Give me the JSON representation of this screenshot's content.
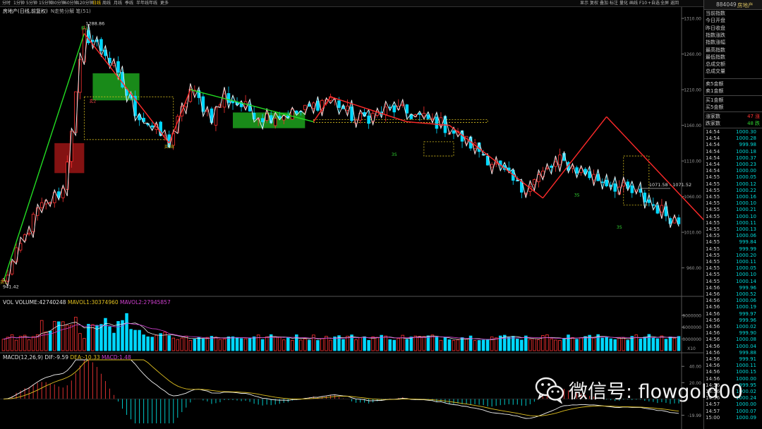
{
  "toolbar": {
    "items": [
      "分时",
      "1分钟",
      "5分钟",
      "15分钟",
      "30分钟",
      "60分钟",
      "120分钟",
      "日线",
      "周线",
      "月线",
      "季线",
      "半年线",
      "年线",
      "更多"
    ],
    "active_index": 7,
    "right_items": [
      "显示",
      "复权",
      "叠加",
      "标注",
      "量化",
      "画线",
      "F10",
      "+自选",
      "全屏",
      "返回"
    ]
  },
  "chart_title": {
    "name": "房地产(日线,前复权)",
    "indicator": "N走势分解 笔(51)"
  },
  "price_axis": {
    "ticks": [
      {
        "label": "1310.00",
        "v": 1310
      },
      {
        "label": "1260.00",
        "v": 1260
      },
      {
        "label": "1210.00",
        "v": 1210
      },
      {
        "label": "1160.00",
        "v": 1160
      },
      {
        "label": "1110.00",
        "v": 1110
      },
      {
        "label": "1060.00",
        "v": 1060
      },
      {
        "label": "1010.00",
        "v": 1010
      },
      {
        "label": "960.00",
        "v": 960
      }
    ],
    "min": 928,
    "max": 1316
  },
  "annotations": {
    "high_label": "1288.86",
    "low_label": "941.42",
    "range_label": "1071.58 - 1071.52",
    "range_value": 1071.5,
    "signals": [
      {
        "label": "买1",
        "i": 0,
        "v": 938,
        "color": "#e0c020"
      },
      {
        "label": "卖1",
        "i": 19,
        "v": 1294,
        "color": "#30d030"
      },
      {
        "label": "卖2",
        "i": 21,
        "v": 1192,
        "color": "#e04040"
      },
      {
        "label": "买3B",
        "i": 39,
        "v": 1128,
        "color": "#e0c020"
      },
      {
        "label": "3S",
        "i": 92,
        "v": 1117,
        "color": "#30d030"
      },
      {
        "label": "3S",
        "i": 135,
        "v": 1060,
        "color": "#30d030"
      },
      {
        "label": "3S",
        "i": 145,
        "v": 1015,
        "color": "#30d030"
      }
    ]
  },
  "vol_legend": {
    "vol": "VOL VOLUME:42740248",
    "mavol1": "MAVOL1:30374960",
    "mavol2": "MAVOL2:27945857"
  },
  "vol_axis": {
    "ticks": [
      {
        "label": "9000000",
        "v": 9000000
      },
      {
        "label": "6000000",
        "v": 6000000
      },
      {
        "label": "3000000",
        "v": 3000000
      }
    ],
    "unit": "X10",
    "max": 11000000
  },
  "macd_legend": {
    "name": "MACD(12,26,9)",
    "dif": "DIF:-9.59",
    "dea": "DEA:-10.33",
    "macd": "MACD:1.48"
  },
  "macd_axis": {
    "ticks": [
      {
        "label": "40.00",
        "v": 40
      },
      {
        "label": "20.00",
        "v": 20
      },
      {
        "label": "-19.99",
        "v": -19.99
      }
    ],
    "min": -30,
    "max": 48
  },
  "side_panel": {
    "code": "884049",
    "name": "房地产",
    "labels": [
      "当前指数",
      "今日开盘",
      "昨日收盘",
      "指数涨跌",
      "指数涨幅",
      "最高指数",
      "最低指数",
      "总成交额",
      "总成交量"
    ],
    "order_labels": [
      "卖5金额",
      "卖1金额",
      "买1金额",
      "买5金额"
    ],
    "up_label": "涨家数",
    "up_value": "47",
    "up_suffix": "涨",
    "down_label": "跌家数",
    "down_value": "48",
    "down_suffix": "跌",
    "trades": [
      {
        "t": "14:54",
        "p": "1000.30"
      },
      {
        "t": "14:54",
        "p": "1000.28"
      },
      {
        "t": "14:54",
        "p": "999.98"
      },
      {
        "t": "14:54",
        "p": "1000.18"
      },
      {
        "t": "14:54",
        "p": "1000.37"
      },
      {
        "t": "14:54",
        "p": "1000.23"
      },
      {
        "t": "14:54",
        "p": "1000.00"
      },
      {
        "t": "14:55",
        "p": "1000.05"
      },
      {
        "t": "14:55",
        "p": "1000.12"
      },
      {
        "t": "14:55",
        "p": "1000.22"
      },
      {
        "t": "14:55",
        "p": "1000.16"
      },
      {
        "t": "14:55",
        "p": "1000.10"
      },
      {
        "t": "14:55",
        "p": "1000.21"
      },
      {
        "t": "14:55",
        "p": "1000.10"
      },
      {
        "t": "14:55",
        "p": "1000.11"
      },
      {
        "t": "14:55",
        "p": "1000.13"
      },
      {
        "t": "14:55",
        "p": "1000.06"
      },
      {
        "t": "14:55",
        "p": "999.84"
      },
      {
        "t": "14:55",
        "p": "999.99"
      },
      {
        "t": "14:55",
        "p": "1000.20"
      },
      {
        "t": "14:55",
        "p": "1000.11"
      },
      {
        "t": "14:55",
        "p": "1000.05"
      },
      {
        "t": "14:55",
        "p": "1000.10"
      },
      {
        "t": "14:55",
        "p": "1000.14"
      },
      {
        "t": "14:56",
        "p": "999.96"
      },
      {
        "t": "14:56",
        "p": "1000.52"
      },
      {
        "t": "14:56",
        "p": "1000.06"
      },
      {
        "t": "14:56",
        "p": "1000.19"
      },
      {
        "t": "14:56",
        "p": "999.97"
      },
      {
        "t": "14:56",
        "p": "999.96"
      },
      {
        "t": "14:56",
        "p": "1000.02"
      },
      {
        "t": "14:56",
        "p": "999.90"
      },
      {
        "t": "14:56",
        "p": "1000.08"
      },
      {
        "t": "14:56",
        "p": "1000.04"
      },
      {
        "t": "14:56",
        "p": "999.88"
      },
      {
        "t": "14:56",
        "p": "999.91"
      },
      {
        "t": "14:56",
        "p": "1000.11"
      },
      {
        "t": "14:56",
        "p": "1000.15"
      },
      {
        "t": "14:56",
        "p": "1000.00"
      },
      {
        "t": "14:56",
        "p": "999.95"
      },
      {
        "t": "14:56",
        "p": "1000.02"
      },
      {
        "t": "14:56",
        "p": "1000.24"
      },
      {
        "t": "14:57",
        "p": "1000.00"
      },
      {
        "t": "14:57",
        "p": "1000.07"
      },
      {
        "t": "15:00",
        "p": "1000.09"
      }
    ]
  },
  "watermark": {
    "text": "微信号: flowgold00"
  },
  "colors": {
    "up": "#ff3232",
    "down": "#00d8ff",
    "bi_red": "#ff2a2a",
    "bi_green": "#22dd22",
    "zone_green": "#22b822",
    "zone_red": "#b01818",
    "dashed": "#d8c020",
    "macd_pos": "#d83030",
    "macd_neg": "#00c8c8"
  },
  "chart_data": {
    "type": "candlestick",
    "count": 158,
    "turning_points": [
      {
        "i": 0,
        "v": 941.42
      },
      {
        "i": 8,
        "v": 1040
      },
      {
        "i": 14,
        "v": 1070
      },
      {
        "i": 19,
        "v": 1288.86
      },
      {
        "i": 24,
        "v": 1262
      },
      {
        "i": 31,
        "v": 1180
      },
      {
        "i": 39,
        "v": 1135
      },
      {
        "i": 44,
        "v": 1210
      },
      {
        "i": 49,
        "v": 1172
      },
      {
        "i": 52,
        "v": 1200
      },
      {
        "i": 61,
        "v": 1172
      },
      {
        "i": 70,
        "v": 1178
      },
      {
        "i": 77,
        "v": 1200
      },
      {
        "i": 83,
        "v": 1167
      },
      {
        "i": 92,
        "v": 1183
      },
      {
        "i": 103,
        "v": 1162
      },
      {
        "i": 112,
        "v": 1125
      },
      {
        "i": 122,
        "v": 1070
      },
      {
        "i": 131,
        "v": 1110
      },
      {
        "i": 138,
        "v": 1090
      },
      {
        "i": 150,
        "v": 1060
      },
      {
        "i": 160,
        "v": 1020
      },
      {
        "i": 170,
        "v": 995
      },
      {
        "i": 179,
        "v": 965
      },
      {
        "i": 190,
        "v": 1033
      },
      {
        "i": 200,
        "v": 1017
      },
      {
        "i": 205,
        "v": 997
      },
      {
        "i": 215,
        "v": 1005
      }
    ],
    "bi": [
      {
        "i": 0,
        "v": 941.42,
        "c": "green"
      },
      {
        "i": 19,
        "v": 1288.86,
        "c": "red"
      },
      {
        "i": 39,
        "v": 1135,
        "c": "red"
      },
      {
        "i": 44,
        "v": 1210,
        "c": "green"
      },
      {
        "i": 73,
        "v": 1165,
        "c": "red"
      },
      {
        "i": 77,
        "v": 1200,
        "c": "red"
      },
      {
        "i": 95,
        "v": 1165,
        "c": "red"
      },
      {
        "i": 105,
        "v": 1160,
        "c": "red"
      },
      {
        "i": 127,
        "v": 1058,
        "c": "red"
      },
      {
        "i": 142,
        "v": 1172,
        "c": "red"
      },
      {
        "i": 170,
        "v": 995,
        "c": "red"
      },
      {
        "i": 179,
        "v": 965,
        "c": "red"
      },
      {
        "i": 190,
        "v": 1060,
        "c": "red"
      }
    ],
    "hubs": [
      {
        "i0": 12,
        "i1": 19,
        "lo": 1093,
        "hi": 1135,
        "type": "red"
      },
      {
        "i0": 21,
        "i1": 32,
        "lo": 1195,
        "hi": 1233,
        "type": "green"
      },
      {
        "i0": 54,
        "i1": 71,
        "lo": 1156,
        "hi": 1178,
        "type": "green"
      },
      {
        "i0": 190,
        "i1": 196,
        "lo": 1031,
        "hi": 1045,
        "type": "green"
      },
      {
        "i0": 203,
        "i1": 213,
        "lo": 1003,
        "hi": 1017,
        "type": "green"
      }
    ],
    "dashed_boxes": [
      {
        "i0": 19,
        "i1": 40,
        "lo": 1140,
        "hi": 1200
      },
      {
        "i0": 73,
        "i1": 114,
        "lo": 1164,
        "hi": 1168
      },
      {
        "i0": 99,
        "i1": 106,
        "lo": 1117,
        "hi": 1137
      },
      {
        "i0": 146,
        "i1": 152,
        "lo": 1048,
        "hi": 1117
      },
      {
        "i0": 177,
        "i1": 188,
        "lo": 978,
        "hi": 1060
      }
    ]
  }
}
